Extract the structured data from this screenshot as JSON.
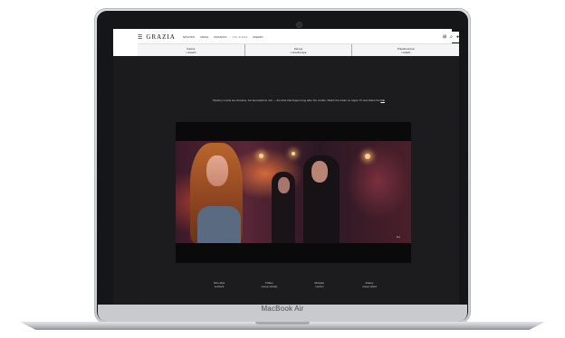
{
  "device": {
    "brand_label": "MacBook Air"
  },
  "site": {
    "logo": "GRAZIA",
    "menu": [
      {
        "label": "Novosti"
      },
      {
        "label": "Moda"
      },
      {
        "label": "Krasota"
      },
      {
        "label": "Stil zhizni",
        "active": true
      },
      {
        "label": "Zvezdy"
      }
    ],
    "subnav": [
      {
        "line1": "Karera",
        "line2": "i uspekh"
      },
      {
        "line1": "Semya",
        "line2": "i otnosheniya"
      },
      {
        "line1": "Puteshestviya",
        "line2": "i otdykh"
      }
    ],
    "intro_text": "Mystery novels are timeless, but atmospheric noir — the kind that lingers long after the credits. Watch the trailer on Apple TV and follow the",
    "intro_link": "link",
    "video": {
      "watermark": "tv+"
    },
    "footer_links": [
      {
        "line1": "Kino dlya",
        "line2": "vechera"
      },
      {
        "line1": "Trillery",
        "line2": "novye serialy"
      },
      {
        "line1": "Muzyka",
        "line2": "i sezon"
      },
      {
        "line1": "Dramy",
        "line2": "novye istorii"
      }
    ]
  }
}
